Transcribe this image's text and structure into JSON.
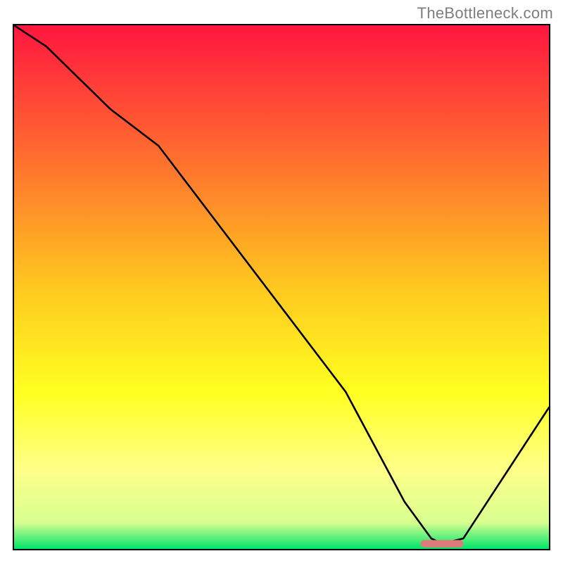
{
  "watermark": "TheBottleneck.com",
  "chart_data": {
    "type": "line",
    "title": "",
    "xlabel": "",
    "ylabel": "",
    "xlim": [
      0,
      100
    ],
    "ylim": [
      0,
      100
    ],
    "grid": false,
    "axes_hidden": true,
    "background": {
      "type": "vertical-gradient",
      "stops": [
        {
          "pos": 0.0,
          "color": "#ff163f"
        },
        {
          "pos": 0.25,
          "color": "#ff6d2f"
        },
        {
          "pos": 0.5,
          "color": "#ffc81f"
        },
        {
          "pos": 0.7,
          "color": "#ffff20"
        },
        {
          "pos": 0.85,
          "color": "#ffff8a"
        },
        {
          "pos": 0.95,
          "color": "#d7ff90"
        },
        {
          "pos": 1.0,
          "color": "#00e46a"
        }
      ]
    },
    "series": [
      {
        "name": "bottleneck-curve",
        "color": "#000000",
        "x": [
          0,
          6,
          18,
          27,
          62,
          73,
          78,
          80,
          84,
          100
        ],
        "values": [
          100,
          96,
          84,
          77,
          30,
          9,
          2,
          1,
          2,
          27
        ]
      }
    ],
    "marker": {
      "name": "optimal-range-marker",
      "shape": "rounded-rect",
      "color": "#e07a7a",
      "x_start": 76,
      "x_end": 84,
      "y": 1,
      "height_pct": 1.4
    }
  }
}
